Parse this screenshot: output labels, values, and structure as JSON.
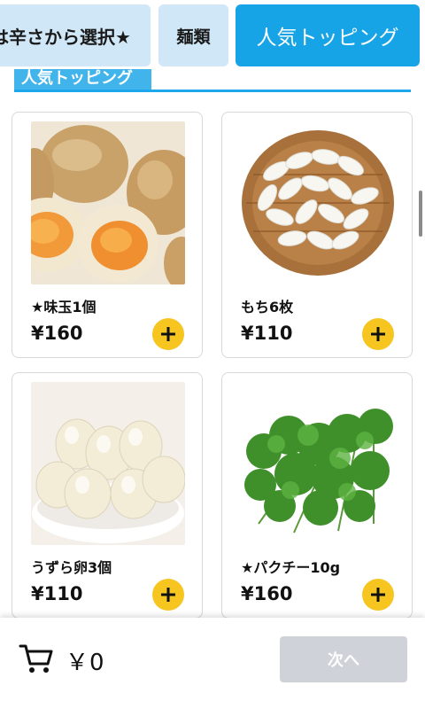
{
  "tabs": [
    {
      "label": "は辛さから選択★"
    },
    {
      "label": "麺類"
    },
    {
      "label": "人気トッピング"
    }
  ],
  "section": {
    "title": "人気トッピング"
  },
  "products": [
    {
      "name": "★味玉1個",
      "price": "¥160",
      "image": "marinated-eggs"
    },
    {
      "name": "もち6枚",
      "price": "¥110",
      "image": "mochi-basket"
    },
    {
      "name": "うずら卵3個",
      "price": "¥110",
      "image": "quail-eggs"
    },
    {
      "name": "★パクチー10g",
      "price": "¥160",
      "image": "coriander"
    }
  ],
  "cart": {
    "total": "￥0",
    "icon": "cart-icon"
  },
  "next_button": {
    "label": "次へ"
  },
  "colors": {
    "active_tab": "#17a4e6",
    "inactive_tab": "#cfe7f6",
    "add_button": "#f6c520",
    "disabled_button": "#cfd2d8"
  }
}
